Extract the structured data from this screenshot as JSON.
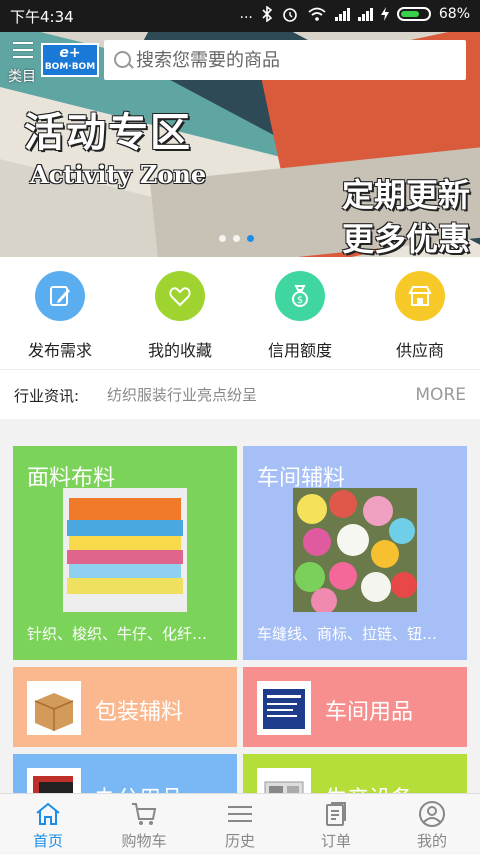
{
  "status_bar": {
    "time": "下午4:34",
    "dots": "...",
    "battery_pct": "68%",
    "battery_level": 0.68
  },
  "header": {
    "menu_label": "类目",
    "logo_line1": "e+",
    "logo_line2": "BOM·BOM",
    "search_placeholder": "搜索您需要的商品"
  },
  "banner": {
    "title_cn": "活动专区",
    "title_en": "Activity Zone",
    "promo_line1": "定期更新",
    "promo_line2": "更多优惠",
    "page_count": 3,
    "active_page": 3
  },
  "quick_actions": [
    {
      "label": "发布需求",
      "icon": "edit-icon",
      "color": "#5aaef0"
    },
    {
      "label": "我的收藏",
      "icon": "heart-icon",
      "color": "#9fd430"
    },
    {
      "label": "信用额度",
      "icon": "money-bag-icon",
      "color": "#3fd6a0"
    },
    {
      "label": "供应商",
      "icon": "store-icon",
      "color": "#f7c928"
    }
  ],
  "news": {
    "label": "行业资讯:",
    "headline": "纺织服装行业亮点纷呈",
    "more": "MORE"
  },
  "categories": [
    {
      "name": "面料布料",
      "sub": "针织、梭织、牛仔、化纤…",
      "color": "#7bd35a"
    },
    {
      "name": "车间辅料",
      "sub": "车缝线、商标、拉链、钮…",
      "color": "#a6bff7"
    },
    {
      "name": "包装辅料",
      "color": "#fbb88f"
    },
    {
      "name": "车间用品",
      "color": "#f78f8f"
    },
    {
      "name": "办公用品",
      "color": "#7ab8f5"
    },
    {
      "name": "生产设备",
      "color": "#b6de3a"
    }
  ],
  "tabbar": [
    {
      "label": "首页",
      "icon": "home-icon",
      "active": true
    },
    {
      "label": "购物车",
      "icon": "cart-icon",
      "active": false
    },
    {
      "label": "历史",
      "icon": "history-icon",
      "active": false
    },
    {
      "label": "订单",
      "icon": "order-icon",
      "active": false
    },
    {
      "label": "我的",
      "icon": "profile-icon",
      "active": false
    }
  ],
  "colors": {
    "accent": "#1b8fe8",
    "status_bg": "#1a1a1a"
  }
}
